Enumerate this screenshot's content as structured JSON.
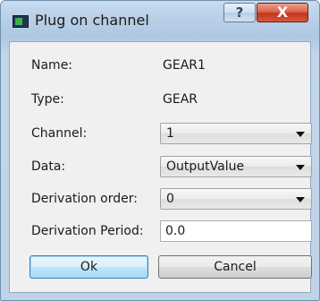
{
  "window": {
    "title": "Plug on channel",
    "help_label": "?",
    "close_label": "X"
  },
  "form": {
    "name_label": "Name:",
    "name_value": "GEAR1",
    "type_label": "Type:",
    "type_value": "GEAR",
    "channel_label": "Channel:",
    "channel_value": "1",
    "data_label": "Data:",
    "data_value": "OutputValue",
    "derivation_order_label": "Derivation order:",
    "derivation_order_value": "0",
    "derivation_period_label": "Derivation Period:",
    "derivation_period_value": "0.0"
  },
  "buttons": {
    "ok_label": "Ok",
    "cancel_label": "Cancel"
  },
  "colors": {
    "title_bar": "#b9cfe6",
    "close_button": "#c2361c",
    "default_button_border": "#3c7fb1",
    "client_background": "#f0f0f0"
  },
  "icons": {
    "app": "app-window-icon",
    "help": "help-icon",
    "close": "close-icon",
    "dropdown": "chevron-down-icon"
  }
}
